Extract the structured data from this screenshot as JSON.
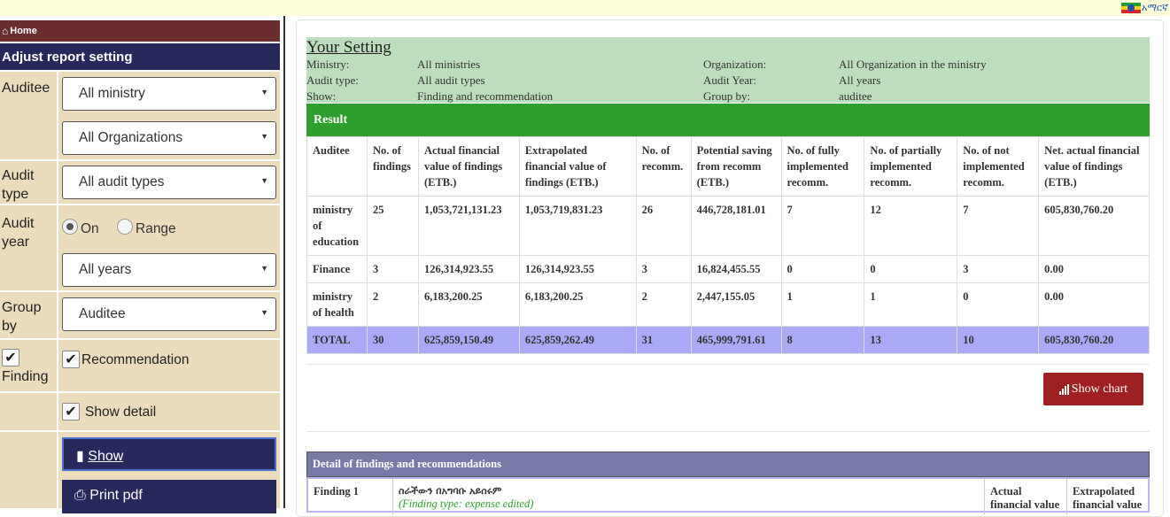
{
  "topbar": {
    "language_label": "አማርኛ",
    "flag_colors": [
      "#1f9e3a",
      "#f7d21b",
      "#d8252a"
    ]
  },
  "sidebar": {
    "home_label": "Home",
    "title": "Adjust report setting",
    "auditee_label": "Auditee",
    "ministry_select": "All ministry",
    "organization_select": "All Organizations",
    "audit_type_label": "Audit type",
    "audit_type_select": "All audit types",
    "audit_year_label": "Audit year",
    "radio_on_label": "On",
    "radio_range_label": "Range",
    "year_select": "All years",
    "group_by_label": "Group by",
    "group_by_select": "Auditee",
    "finding_label": "Finding",
    "recommendation_label": "Recommendation",
    "show_detail_label": "Show detail",
    "show_button": "Show",
    "print_button": "Print pdf"
  },
  "setting": {
    "title": "Your Setting",
    "ministry_key": "Ministry:",
    "ministry_value": "All ministries",
    "audit_type_key": "Audit type:",
    "audit_type_value": "All audit types",
    "show_key": "Show:",
    "show_value": "Finding and recommendation",
    "organization_key": "Organization:",
    "organization_value": "All Organization in the ministry",
    "audit_year_key": "Audit Year:",
    "audit_year_value": "All years",
    "group_by_key": "Group by:",
    "group_by_value": "auditee"
  },
  "result": {
    "title": "Result",
    "headers": [
      "Auditee",
      "No. of findings",
      "Actual financial value of findings (ETB.)",
      "Extrapolated financial value of findings (ETB.)",
      "No. of recomm.",
      "Potential saving from recomm (ETB.)",
      "No. of fully implemented recomm.",
      "No. of partially implemented recomm.",
      "No. of not implemented recomm.",
      "Net. actual financial value of findings (ETB.)"
    ],
    "rows": [
      [
        "ministry of education",
        "25",
        "1,053,721,131.23",
        "1,053,719,831.23",
        "26",
        "446,728,181.01",
        "7",
        "12",
        "7",
        "605,830,760.20"
      ],
      [
        "Finance",
        "3",
        "126,314,923.55",
        "126,314,923.55",
        "3",
        "16,824,455.55",
        "0",
        "0",
        "3",
        "0.00"
      ],
      [
        "ministry of health",
        "2",
        "6,183,200.25",
        "6,183,200.25",
        "2",
        "2,447,155.05",
        "1",
        "1",
        "0",
        "0.00"
      ]
    ],
    "total": [
      "TOTAL",
      "30",
      "625,859,150.49",
      "625,859,262.49",
      "31",
      "465,999,791.61",
      "8",
      "13",
      "10",
      "605,830,760.20"
    ]
  },
  "show_chart_button": "Show chart",
  "detail": {
    "title": "Detail of findings and recommendations",
    "finding_label": "Finding 1",
    "finding_text": "ስራችውን በአግባቡ አይሰሩም",
    "finding_type": "(Finding type: expense edited)",
    "col_actual": "Actual financial value",
    "col_extrapolated": "Extrapolated financial value"
  }
}
